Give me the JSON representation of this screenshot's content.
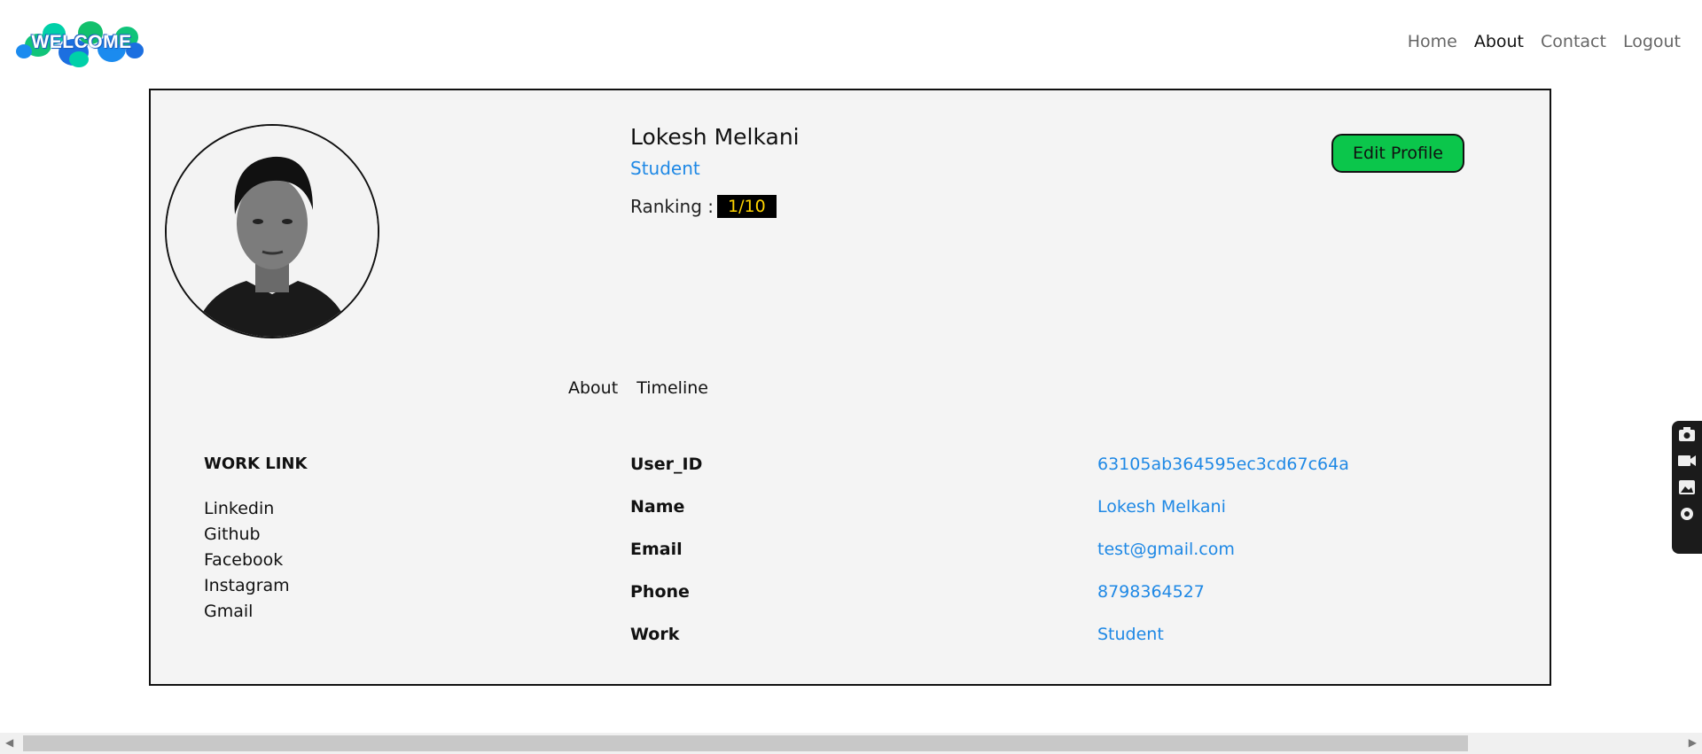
{
  "logo": {
    "text": "WELCOME"
  },
  "nav": {
    "items": [
      "Home",
      "About",
      "Contact",
      "Logout"
    ]
  },
  "profile": {
    "name": "Lokesh Melkani",
    "role": "Student",
    "ranking_label": "Ranking :",
    "ranking_value": "1/10",
    "edit_label": "Edit Profile"
  },
  "tabs": [
    "About",
    "Timeline"
  ],
  "work": {
    "title": "WORK LINK",
    "links": [
      "Linkedin",
      "Github",
      "Facebook",
      "Instagram",
      "Gmail"
    ]
  },
  "info": {
    "labels": [
      "User_ID",
      "Name",
      "Email",
      "Phone",
      "Work"
    ],
    "values": [
      "63105ab364595ec3cd67c64a",
      "Lokesh Melkani",
      "test@gmail.com",
      "8798364527",
      "Student"
    ]
  },
  "colors": {
    "accent": "#1e88e5",
    "button": "#0bc64b",
    "badge_text": "#ffd400"
  },
  "side_tools": [
    "camera-icon",
    "video-icon",
    "gallery-icon",
    "gear-icon"
  ]
}
